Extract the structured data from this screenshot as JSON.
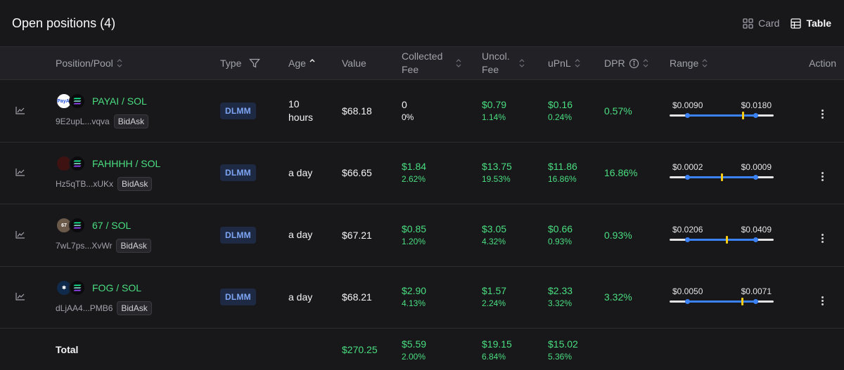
{
  "header": {
    "title": "Open positions (4)",
    "views": [
      {
        "label": "Card",
        "icon": "grid-icon",
        "active": false
      },
      {
        "label": "Table",
        "icon": "table-icon",
        "active": true
      }
    ]
  },
  "columns": {
    "position": "Position/Pool",
    "type": "Type",
    "age": "Age",
    "value": "Value",
    "collected_fee_line1": "Collected",
    "collected_fee_line2": "Fee",
    "uncol_fee_line1": "Uncol.",
    "uncol_fee_line2": "Fee",
    "upnl": "uPnL",
    "dpr": "DPR",
    "range": "Range",
    "action": "Action"
  },
  "positions": [
    {
      "pair": "PAYAI / SOL",
      "address": "9E2upL...vqva",
      "strategy": "BidAsk",
      "type": "DLMM",
      "age_line1": "10",
      "age_line2": "hours",
      "value": "$68.18",
      "collected_fee": "0",
      "collected_fee_pct": "0%",
      "uncol_fee": "$0.79",
      "uncol_fee_pct": "1.14%",
      "upnl": "$0.16",
      "upnl_pct": "0.24%",
      "dpr": "0.57%",
      "range_low": "$0.0090",
      "range_high": "$0.0180",
      "range_current_fraction": 0.81,
      "token_color": "#ffffff",
      "token_text": "PayAI",
      "token_text_color": "#1d4ed8"
    },
    {
      "pair": "FAHHHH / SOL",
      "address": "Hz5qTB...xUKx",
      "strategy": "BidAsk",
      "type": "DLMM",
      "age_line1": "a day",
      "age_line2": "",
      "value": "$66.65",
      "collected_fee": "$1.84",
      "collected_fee_pct": "2.62%",
      "uncol_fee": "$13.75",
      "uncol_fee_pct": "19.53%",
      "upnl": "$11.86",
      "upnl_pct": "16.86%",
      "dpr": "16.86%",
      "range_low": "$0.0002",
      "range_high": "$0.0009",
      "range_current_fraction": 0.5,
      "token_color": "#3f1212",
      "token_text": "",
      "token_text_color": "#ffffff"
    },
    {
      "pair": "67 / SOL",
      "address": "7wL7ps...XvWr",
      "strategy": "BidAsk",
      "type": "DLMM",
      "age_line1": "a day",
      "age_line2": "",
      "value": "$67.21",
      "collected_fee": "$0.85",
      "collected_fee_pct": "1.20%",
      "uncol_fee": "$3.05",
      "uncol_fee_pct": "4.32%",
      "upnl": "$0.66",
      "upnl_pct": "0.93%",
      "dpr": "0.93%",
      "range_low": "$0.0206",
      "range_high": "$0.0409",
      "range_current_fraction": 0.58,
      "token_color": "#6b5a4a",
      "token_text": "67",
      "token_text_color": "#ffffff"
    },
    {
      "pair": "FOG / SOL",
      "address": "dLjAA4...PMB6",
      "strategy": "BidAsk",
      "type": "DLMM",
      "age_line1": "a day",
      "age_line2": "",
      "value": "$68.21",
      "collected_fee": "$2.90",
      "collected_fee_pct": "4.13%",
      "uncol_fee": "$1.57",
      "uncol_fee_pct": "2.24%",
      "upnl": "$2.33",
      "upnl_pct": "3.32%",
      "dpr": "3.32%",
      "range_low": "$0.0050",
      "range_high": "$0.0071",
      "range_current_fraction": 0.8,
      "token_color": "#0f2a4a",
      "token_text": "✱",
      "token_text_color": "#ffffff"
    }
  ],
  "total": {
    "label": "Total",
    "value": "$270.25",
    "collected_fee": "$5.59",
    "collected_fee_pct": "2.00%",
    "uncol_fee": "$19.15",
    "uncol_fee_pct": "6.84%",
    "upnl": "$15.02",
    "upnl_pct": "5.36%"
  },
  "colors": {
    "accent_green": "#4ade80",
    "accent_blue": "#3b82f6",
    "current_price": "#facc15",
    "background": "#18181b"
  }
}
